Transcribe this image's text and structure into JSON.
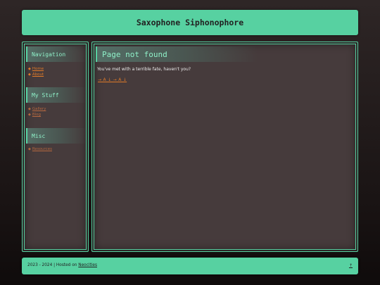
{
  "site": {
    "title": "Saxophone Siphonophore"
  },
  "sidebar": {
    "sections": [
      {
        "heading": "Navigation",
        "items": [
          {
            "icon": "◆",
            "label": "Home"
          },
          {
            "icon": "◆",
            "label": "About"
          }
        ]
      },
      {
        "heading": "My Stuff",
        "items": [
          {
            "icon": "◆",
            "label": "Gallery"
          },
          {
            "icon": "◆",
            "label": "Blog"
          }
        ]
      },
      {
        "heading": "Misc",
        "items": [
          {
            "icon": "◆",
            "label": "Resources"
          }
        ]
      }
    ]
  },
  "main": {
    "heading": "Page not found",
    "message": "You've met with a terrible fate, haven't you?",
    "link": "→ A ↓ → A ↓"
  },
  "footer": {
    "text": "2023 - 2024 | Hosted on ",
    "link": "Neocities",
    "top_link": "↑"
  },
  "colors": {
    "accent": "#57d1a1",
    "panel": "#463b3c",
    "link": "#e07a28"
  }
}
